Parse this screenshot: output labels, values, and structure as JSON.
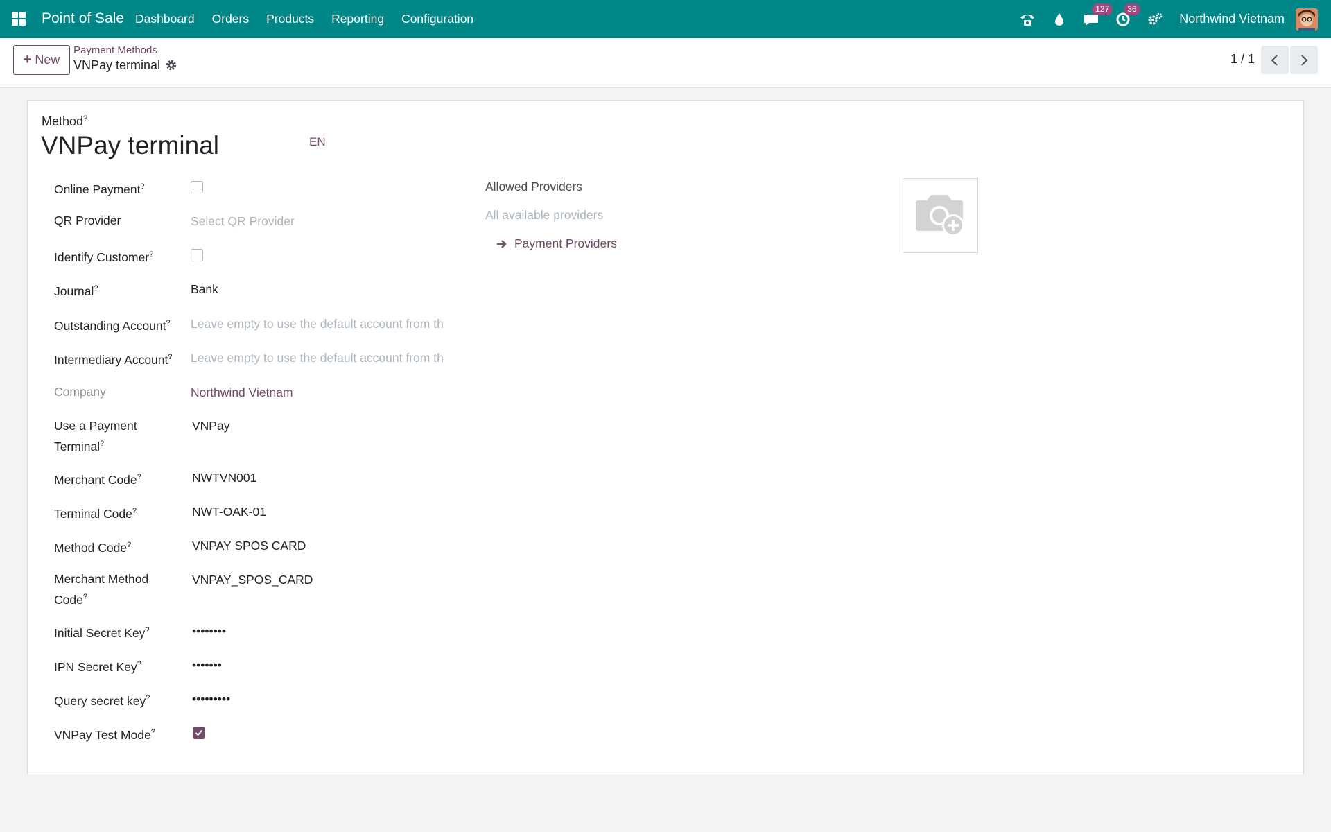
{
  "navbar": {
    "app_title": "Point of Sale",
    "menu": [
      "Dashboard",
      "Orders",
      "Products",
      "Reporting",
      "Configuration"
    ],
    "messages_count": "127",
    "activities_count": "36",
    "company": "Northwind Vietnam"
  },
  "control_panel": {
    "new_label": "New",
    "breadcrumb_parent": "Payment Methods",
    "breadcrumb_current": "VNPay terminal",
    "pager": "1 / 1"
  },
  "form": {
    "method_label": "Method",
    "method_name": "VNPay terminal",
    "lang": "EN",
    "online_payment_label": "Online Payment",
    "online_payment_checked": false,
    "qr_provider_label": "QR Provider",
    "qr_provider_placeholder": "Select QR Provider",
    "identify_customer_label": "Identify Customer",
    "identify_customer_checked": false,
    "journal_label": "Journal",
    "journal_value": "Bank",
    "outstanding_account_label": "Outstanding Account",
    "outstanding_account_placeholder": "Leave empty to use the default account from th",
    "intermediary_account_label": "Intermediary Account",
    "intermediary_account_placeholder": "Leave empty to use the default account from th",
    "company_label": "Company",
    "company_value": "Northwind Vietnam",
    "payment_terminal_label_1": "Use a Payment",
    "payment_terminal_label_2": "Terminal",
    "payment_terminal_value": "VNPay",
    "merchant_code_label": "Merchant Code",
    "merchant_code_value": "NWTVN001",
    "terminal_code_label": "Terminal Code",
    "terminal_code_value": "NWT-OAK-01",
    "method_code_label": "Method Code",
    "method_code_value": "VNPAY SPOS CARD",
    "merchant_method_code_label_1": "Merchant Method",
    "merchant_method_code_label_2": "Code",
    "merchant_method_code_value": "VNPAY_SPOS_CARD",
    "initial_secret_key_label": "Initial Secret Key",
    "initial_secret_key_value": "••••••••",
    "ipn_secret_key_label": "IPN Secret Key",
    "ipn_secret_key_value": "•••••••",
    "query_secret_key_label": "Query secret key",
    "query_secret_key_value": "•••••••••",
    "test_mode_label": "VNPay Test Mode",
    "test_mode_checked": true,
    "allowed_providers_label": "Allowed Providers",
    "allowed_providers_placeholder": "All available providers",
    "payment_providers_link": "Payment Providers",
    "help_marker": "?"
  },
  "colors": {
    "navbar": "#018788",
    "brand": "#714b67",
    "badge": "#a2467f"
  }
}
